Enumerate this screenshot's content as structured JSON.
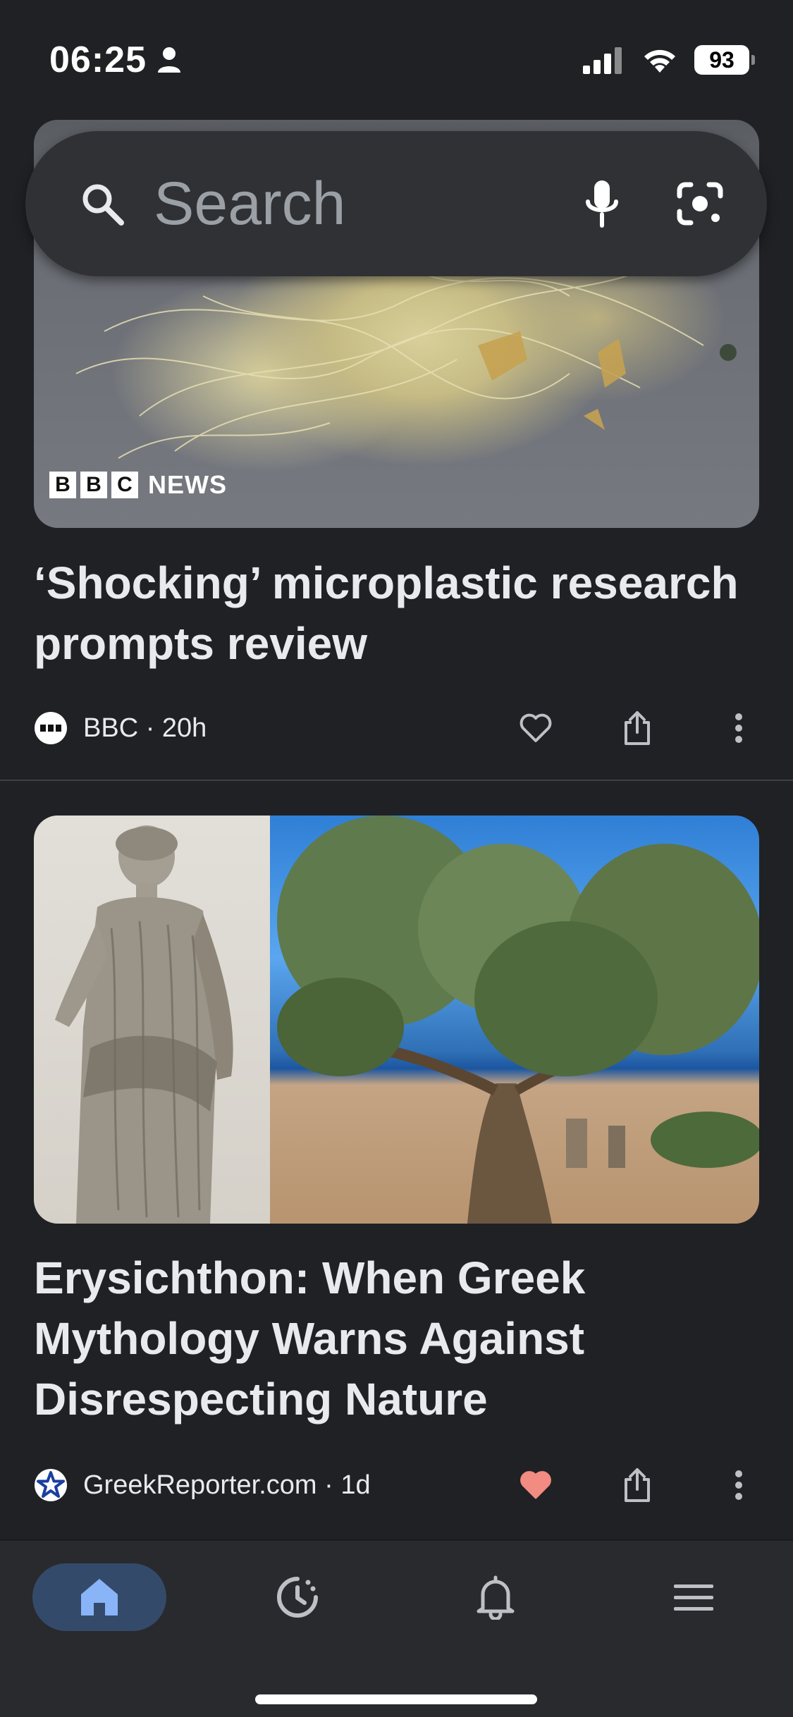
{
  "status_bar": {
    "time": "06:25",
    "battery": "93"
  },
  "search": {
    "placeholder": "Search"
  },
  "articles": [
    {
      "image_brand": {
        "blocks": [
          "B",
          "B",
          "C"
        ],
        "label": "NEWS"
      },
      "headline": "‘Shocking’ microplastic research prompts review",
      "source": "BBC · 20h",
      "liked": false
    },
    {
      "headline": "Erysichthon: When Greek Mythology Warns Against Disrespecting Nature",
      "source": "GreekReporter.com · 1d",
      "liked": true
    }
  ],
  "bottom_nav": {
    "items": [
      {
        "icon": "home-icon",
        "active": true
      },
      {
        "icon": "history-icon",
        "active": false
      },
      {
        "icon": "bell-icon",
        "active": false
      },
      {
        "icon": "menu-icon",
        "active": false
      }
    ]
  },
  "colors": {
    "background": "#202124",
    "search_bg": "#303134",
    "liked_heart": "#f28b82",
    "nav_active": "#344a6a",
    "nav_active_icon": "#8ab4f8"
  }
}
